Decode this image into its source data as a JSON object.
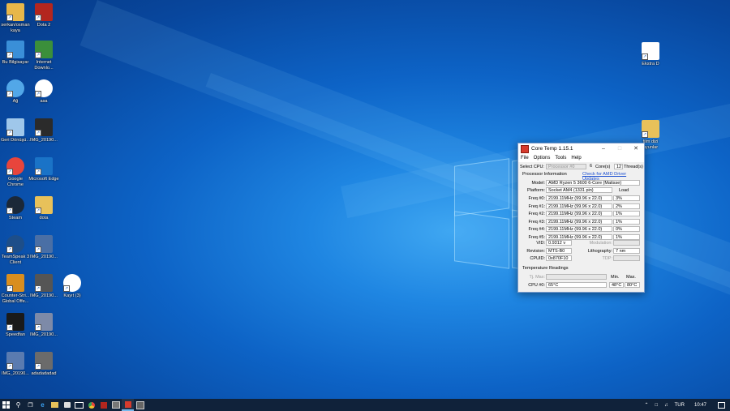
{
  "desktop_icons": [
    {
      "label": "serkan/osman kaya",
      "icon": "folder-user-icon",
      "color": "#e8b74a"
    },
    {
      "label": "Dota 2",
      "icon": "dota-icon",
      "color": "#b3261e"
    },
    {
      "label": "Bu Bilgisayar",
      "icon": "computer-icon",
      "color": "#3a8fd8"
    },
    {
      "label": "Internet Downlo...",
      "icon": "idm-icon",
      "color": "#3b8f3b"
    },
    {
      "label": "Ağ",
      "icon": "network-icon",
      "color": "#52a7e8"
    },
    {
      "label": "asa",
      "icon": "disc-icon",
      "color": "#ffffff"
    },
    {
      "label": "Geri Dönüşü...",
      "icon": "recycle-bin-icon",
      "color": "#9fc7ea"
    },
    {
      "label": "IMG_20190...",
      "icon": "image-icon",
      "color": "#2b2b2b"
    },
    {
      "label": "Google Chrome",
      "icon": "chrome-icon",
      "color": "#e8453c"
    },
    {
      "label": "Microsoft Edge",
      "icon": "edge-icon",
      "color": "#1a73c7"
    },
    {
      "label": "Steam",
      "icon": "steam-icon",
      "color": "#1b2838"
    },
    {
      "label": "dota",
      "icon": "folder-icon",
      "color": "#e8c15a"
    },
    {
      "label": "TeamSpeak 3 Client",
      "icon": "teamspeak-icon",
      "color": "#1d4e89"
    },
    {
      "label": "IMG_20190...",
      "icon": "image-icon",
      "color": "#4a6fa5"
    },
    {
      "label": "Counter-Stri... Global Offe...",
      "icon": "csgo-icon",
      "color": "#d98e1f"
    },
    {
      "label": "IMG_20190...",
      "icon": "image-icon",
      "color": "#555555"
    },
    {
      "label": "Kayıt (3)",
      "icon": "disc-icon",
      "color": "#ffffff"
    },
    {
      "label": "Speedfan",
      "icon": "speedfan-icon",
      "color": "#1a1a1a"
    },
    {
      "label": "IMG_20190...",
      "icon": "image-icon",
      "color": "#7d8aa8"
    },
    {
      "label": "IMG_20190...",
      "icon": "image-icon",
      "color": "#5a7bb0"
    },
    {
      "label": "adadadadad",
      "icon": "image-icon",
      "color": "#6b6b6b"
    },
    {
      "label": "Ekstra D",
      "icon": "media-file-icon",
      "color": "#ffffff"
    },
    {
      "label": "film dizi oyunlar",
      "icon": "folder-icon",
      "color": "#e8c15a"
    }
  ],
  "window": {
    "title": "Core Temp 1.15.1",
    "menu": [
      "File",
      "Options",
      "Tools",
      "Help"
    ],
    "select_cpu_label": "Select CPU:",
    "processor_value": "Processor #0",
    "cores_value": "6",
    "cores_label": "Core(s)",
    "threads_value": "12",
    "threads_label": "Thread(s)",
    "processor_info_label": "Processor Information",
    "driver_link": "Check for AMD Driver Updates",
    "model_label": "Model:",
    "model_value": "AMD Ryzen 5 3600 6-Core (Matisse)",
    "platform_label": "Platform:",
    "platform_value": "Socket AM4 (1331 pin)",
    "load_label": "Load",
    "freqs": [
      {
        "label": "Freq #0:",
        "value": "2199.11MHz (99.96 x 22.0)",
        "load": "3%"
      },
      {
        "label": "Freq #1:",
        "value": "2199.11MHz (99.96 x 22.0)",
        "load": "2%"
      },
      {
        "label": "Freq #2:",
        "value": "2199.11MHz (99.96 x 22.0)",
        "load": "1%"
      },
      {
        "label": "Freq #3:",
        "value": "2199.11MHz (99.96 x 22.0)",
        "load": "1%"
      },
      {
        "label": "Freq #4:",
        "value": "2199.11MHz (99.96 x 22.0)",
        "load": "0%"
      },
      {
        "label": "Freq #5:",
        "value": "2199.11MHz (99.96 x 22.0)",
        "load": "1%"
      }
    ],
    "vid_label": "VID:",
    "vid_value": "0.9312 v",
    "modulation_label": "Modulation:",
    "revision_label": "Revision:",
    "revision_value": "MTS-B0",
    "lithography_label": "Lithography:",
    "lithography_value": "7 nm",
    "cpuid_label": "CPUID:",
    "cpuid_value": "0x870F10",
    "tdp_label": "TDP:",
    "temp_readings_label": "Temperature Readings",
    "tjmax_label": "Tj. Max:",
    "min_label": "Min.",
    "max_label": "Max.",
    "cpu0_label": "CPU #0:",
    "cpu0_value": "65°C",
    "cpu0_min": "48°C",
    "cpu0_max": "80°C"
  },
  "taskbar": {
    "lang": "TUR",
    "time": "10:47"
  }
}
